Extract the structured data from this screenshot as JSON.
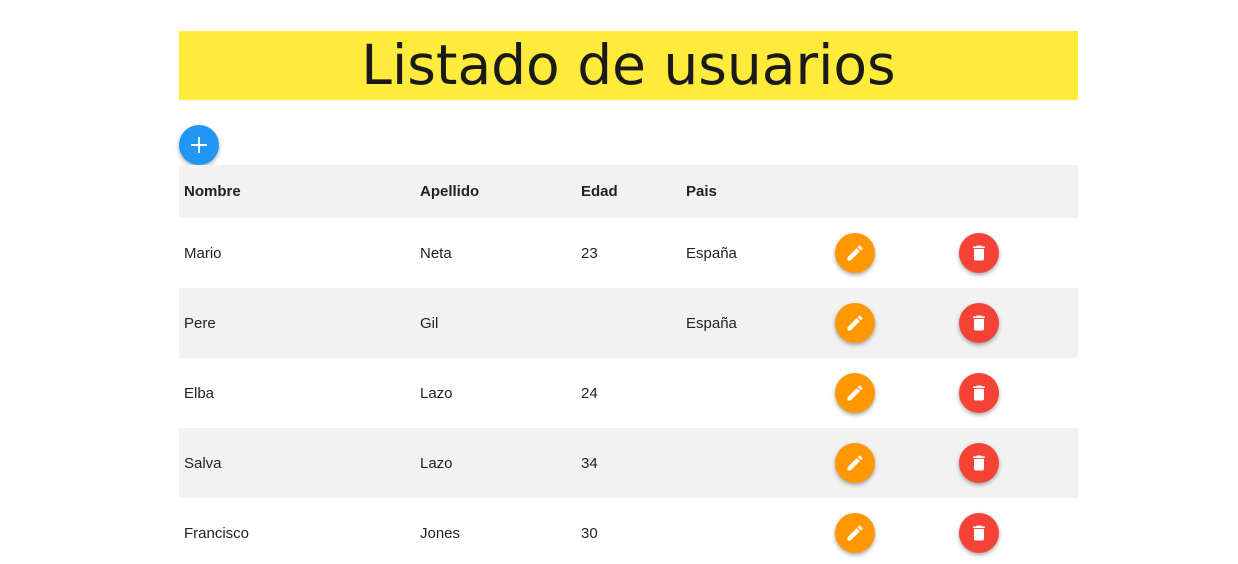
{
  "title": "Listado de usuarios",
  "colors": {
    "title_background": "#ffeb3b",
    "add_button": "#2196f3",
    "edit_button": "#ff9800",
    "delete_button": "#f44336",
    "row_stripe": "#f2f2f2"
  },
  "add_button": {
    "icon": "plus-icon"
  },
  "table": {
    "headers": [
      "Nombre",
      "Apellido",
      "Edad",
      "Pais"
    ],
    "rows": [
      {
        "nombre": "Mario",
        "apellido": "Neta",
        "edad": "23",
        "pais": "España"
      },
      {
        "nombre": "Pere",
        "apellido": "Gil",
        "edad": "",
        "pais": "España"
      },
      {
        "nombre": "Elba",
        "apellido": "Lazo",
        "edad": "24",
        "pais": ""
      },
      {
        "nombre": "Salva",
        "apellido": "Lazo",
        "edad": "34",
        "pais": ""
      },
      {
        "nombre": "Francisco",
        "apellido": "Jones",
        "edad": "30",
        "pais": ""
      }
    ],
    "row_actions": {
      "edit_icon": "pencil-icon",
      "delete_icon": "trash-icon"
    }
  }
}
